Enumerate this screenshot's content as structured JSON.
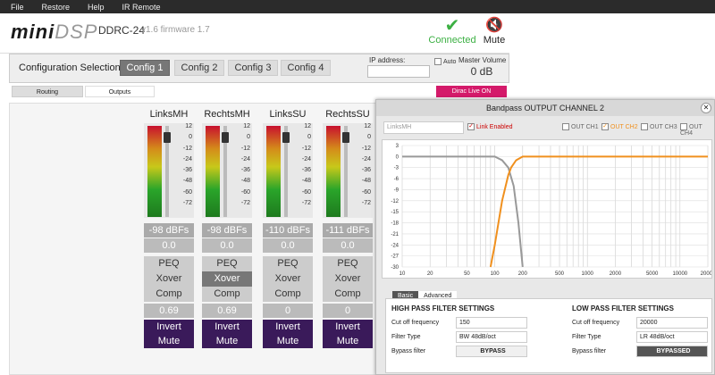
{
  "menu": [
    "File",
    "Restore",
    "Help",
    "IR Remote"
  ],
  "header": {
    "logo_a": "mini",
    "logo_b": "DSP",
    "device": "DDRC-24",
    "firmware": "v1.6 firmware 1.7",
    "connected": "Connected",
    "mute": "Mute"
  },
  "config": {
    "label": "Configuration Selection:",
    "items": [
      "Config 1",
      "Config 2",
      "Config 3",
      "Config 4"
    ],
    "active": 0,
    "ip_label": "IP address:",
    "auto": "Auto",
    "master_label": "Master Volume",
    "master_value": "0 dB"
  },
  "tabs": {
    "routing": "Routing",
    "outputs": "Outputs",
    "dirac": "Dirac Live ON"
  },
  "scale": [
    "12",
    "0",
    "-12",
    "-24",
    "-36",
    "-48",
    "-60",
    "-72"
  ],
  "channels": [
    {
      "name": "LinksMH",
      "dbfs": "-98 dBFs",
      "gain": "0.0",
      "peq": "PEQ",
      "xover": "Xover",
      "comp": "Comp",
      "value": "0.69",
      "invert": "Invert",
      "mute": "Mute",
      "xover_selected": false
    },
    {
      "name": "RechtsMH",
      "dbfs": "-98 dBFs",
      "gain": "0.0",
      "peq": "PEQ",
      "xover": "Xover",
      "comp": "Comp",
      "value": "0.69",
      "invert": "Invert",
      "mute": "Mute",
      "xover_selected": true
    },
    {
      "name": "LinksSU",
      "dbfs": "-110 dBFs",
      "gain": "0.0",
      "peq": "PEQ",
      "xover": "Xover",
      "comp": "Comp",
      "value": "0",
      "invert": "Invert",
      "mute": "Mute",
      "xover_selected": false
    },
    {
      "name": "RechtsSU",
      "dbfs": "-111 dBFs",
      "gain": "0.0",
      "peq": "PEQ",
      "xover": "Xover",
      "comp": "Comp",
      "value": "0",
      "invert": "Invert",
      "mute": "Mute",
      "xover_selected": false
    }
  ],
  "dialog": {
    "title": "Bandpass OUTPUT CHANNEL 2",
    "channel_name": "LinksMH",
    "link": "Link Enabled",
    "outs": [
      "OUT CH1",
      "OUT CH2",
      "OUT CH3",
      "OUT CH4"
    ],
    "tab_basic": "Basic",
    "tab_advanced": "Advanced",
    "hp": {
      "title": "HIGH PASS FILTER SETTINGS",
      "cutoff_label": "Cut off frequency",
      "cutoff": "150",
      "type_label": "Filter Type",
      "type": "BW 48dB/oct",
      "bypass_label": "Bypass filter",
      "bypass": "BYPASS"
    },
    "lp": {
      "title": "LOW PASS FILTER SETTINGS",
      "cutoff_label": "Cut off frequency",
      "cutoff": "20000",
      "type_label": "Filter Type",
      "type": "LR 48dB/oct",
      "bypass_label": "Bypass filter",
      "bypass": "BYPASSED"
    }
  },
  "chart_data": {
    "type": "line",
    "title": "",
    "xlabel": "",
    "ylabel": "",
    "x_scale": "log",
    "xlim": [
      10,
      20000
    ],
    "ylim": [
      -30,
      3
    ],
    "x_ticks": [
      "10",
      "20",
      "50",
      "100",
      "200",
      "500",
      "1000",
      "2000",
      "5000",
      "10000",
      "20000"
    ],
    "y_ticks": [
      "3",
      "0",
      "-3",
      "-6",
      "-9",
      "-12",
      "-15",
      "-18",
      "-21",
      "-24",
      "-27",
      "-30"
    ],
    "grid": true,
    "colors": {
      "ch1": "#999999",
      "ch2": "#f0901e"
    },
    "series": [
      {
        "name": "OUT CH1",
        "x": [
          10,
          100,
          120,
          140,
          160,
          180,
          200
        ],
        "y": [
          0,
          0,
          -1,
          -3,
          -8,
          -18,
          -30
        ]
      },
      {
        "name": "OUT CH2",
        "x": [
          90,
          100,
          120,
          140,
          150,
          170,
          200,
          300,
          1000,
          20000
        ],
        "y": [
          -30,
          -24,
          -12,
          -5,
          -3,
          -1,
          0,
          0,
          0,
          0
        ]
      }
    ]
  }
}
